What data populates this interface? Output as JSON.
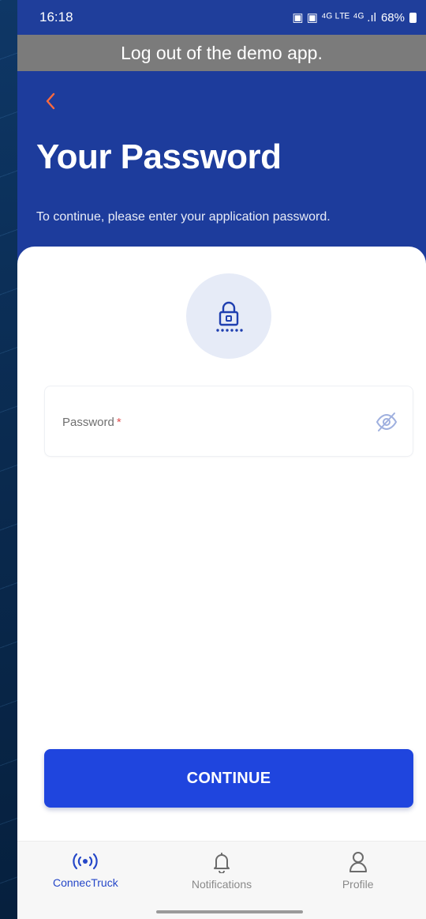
{
  "status_bar": {
    "time": "16:18",
    "indicators": "▣ ▣ ⁴ᴳ ᴸᵀᴱ ⁴ᴳ .ıl",
    "battery": "68%"
  },
  "demo_banner": {
    "text": "Log out of the demo app."
  },
  "header": {
    "back_icon": "chevron-left-icon",
    "title": "Your Password",
    "subtitle": "To continue, please enter your application password."
  },
  "form": {
    "lock_icon": "lock-password-icon",
    "password_label": "Password",
    "required_marker": "*",
    "visibility_icon": "eye-off-icon"
  },
  "actions": {
    "continue_label": "CONTINUE"
  },
  "bottom_nav": {
    "items": [
      {
        "label": "ConnecTruck",
        "icon": "broadcast-icon",
        "active": true
      },
      {
        "label": "Notifications",
        "icon": "bell-icon",
        "active": false
      },
      {
        "label": "Profile",
        "icon": "user-icon",
        "active": false
      }
    ]
  },
  "colors": {
    "primary": "#1f45de",
    "header_bg": "#1d3c9c",
    "back_accent": "#ff6a3d",
    "banner_bg": "#7b7b7b",
    "lock_circle_bg": "#e6ebf7",
    "required": "#e05050",
    "nav_active": "#2547c8"
  }
}
